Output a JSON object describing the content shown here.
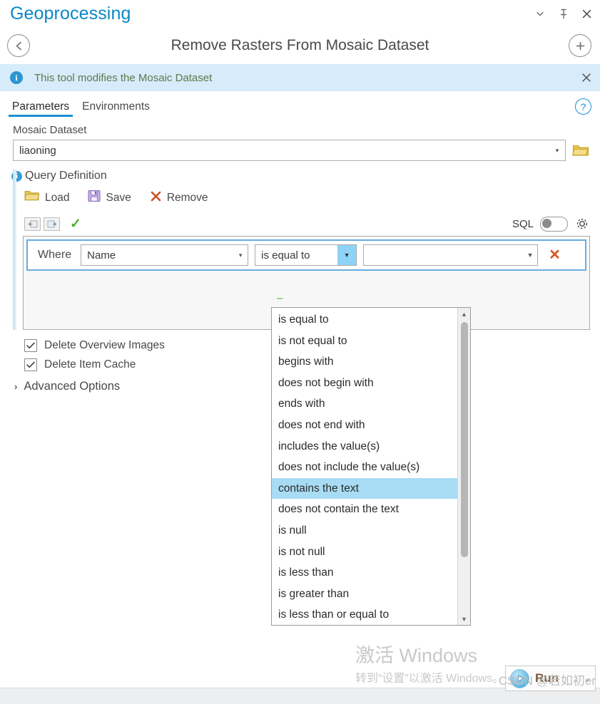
{
  "window": {
    "app_title": "Geoprocessing",
    "controls": {
      "collapse": "chevron-down",
      "pin": "pin",
      "close": "close"
    }
  },
  "tool_header": {
    "back_label": "←",
    "title": "Remove Rasters From Mosaic Dataset",
    "add_label": "+"
  },
  "info_banner": {
    "text": "This tool modifies the Mosaic Dataset",
    "close_label": "✕",
    "background": "#d6ecfa",
    "text_color": "#5a7a49"
  },
  "tabs": {
    "items": [
      {
        "label": "Parameters",
        "active": true
      },
      {
        "label": "Environments",
        "active": false
      }
    ],
    "help_label": "?",
    "accent": "#1a8fd4"
  },
  "mosaic_dataset": {
    "label": "Mosaic Dataset",
    "value": "liaoning",
    "browse_icon": "folder-icon"
  },
  "query_definition": {
    "title": "Query Definition",
    "tools": [
      {
        "label": "Load",
        "icon": "folder-open-icon"
      },
      {
        "label": "Save",
        "icon": "floppy-disk-icon"
      },
      {
        "label": "Remove",
        "icon": "x-icon"
      }
    ],
    "sql_label": "SQL",
    "sql_enabled": false,
    "gear_icon": "gear-icon",
    "insert_before_icon": "insert-before-icon",
    "insert_after_icon": "insert-after-icon",
    "validate_icon": "green-check-icon",
    "clause": {
      "where_label": "Where",
      "field_value": "Name",
      "operator_value": "is equal to",
      "input_value": "",
      "remove_label": "✕"
    }
  },
  "operator_dropdown": {
    "selected": "contains the text",
    "options": [
      "is equal to",
      "is not equal to",
      "begins with",
      "does not begin with",
      "ends with",
      "does not end with",
      "includes the value(s)",
      "does not include the value(s)",
      "contains the text",
      "does not contain the text",
      "is null",
      "is not null",
      "is less than",
      "is greater than",
      "is less than or equal to"
    ],
    "scroll_up": "▲",
    "scroll_down": "▼",
    "highlight_color": "#a8dcf5"
  },
  "options": {
    "checkboxes": [
      {
        "label": "Delete Overview Images",
        "checked": true
      },
      {
        "label": "Delete Item Cache",
        "checked": true
      }
    ],
    "advanced": {
      "label": "Advanced Options",
      "expanded": false,
      "chevron": "›"
    }
  },
  "watermark": {
    "line1": "激活 Windows",
    "line2": "转到“设置”以激活 Windows。",
    "credit": "CSDN @若如初er"
  },
  "run": {
    "label": "Run",
    "icon": "play-icon",
    "caret": "⌄"
  }
}
